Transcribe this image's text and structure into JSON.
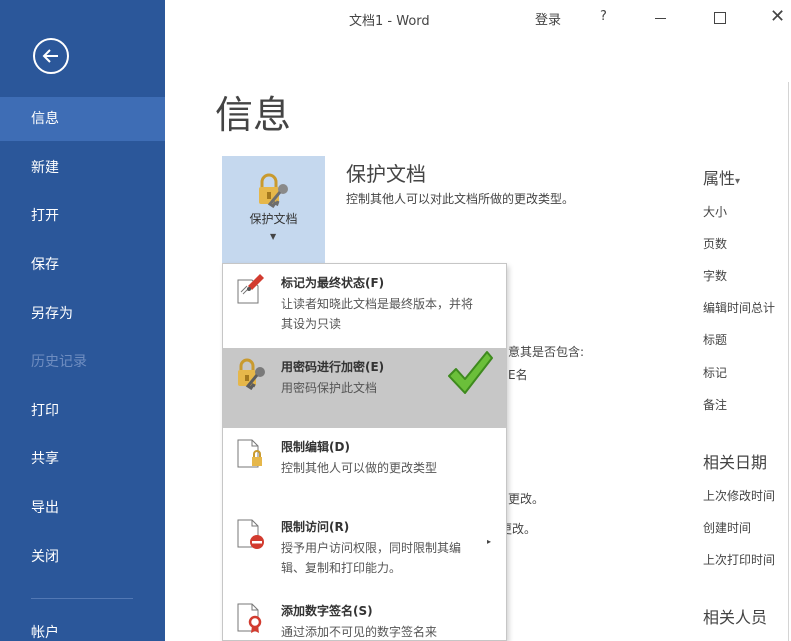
{
  "window": {
    "title": "文档1  -  Word",
    "login": "登录",
    "help": "?"
  },
  "sidebar": {
    "items": [
      {
        "label": "信息",
        "state": "active"
      },
      {
        "label": "新建",
        "state": "normal"
      },
      {
        "label": "打开",
        "state": "normal"
      },
      {
        "label": "保存",
        "state": "normal"
      },
      {
        "label": "另存为",
        "state": "normal"
      },
      {
        "label": "历史记录",
        "state": "disabled"
      },
      {
        "label": "打印",
        "state": "normal"
      },
      {
        "label": "共享",
        "state": "normal"
      },
      {
        "label": "导出",
        "state": "normal"
      },
      {
        "label": "关闭",
        "state": "normal"
      },
      {
        "label": "帐户",
        "state": "normal"
      }
    ]
  },
  "main": {
    "title": "信息",
    "protect": {
      "button_label": "保护文档",
      "heading": "保护文档",
      "description": "控制其他人可以对此文档所做的更改类型。"
    },
    "background_text": {
      "inspect_line": "意其是否包含:",
      "inspect_line2": "E名",
      "versions_line1": "刀更改。",
      "versions_line2": "更改。"
    },
    "properties": {
      "title": "属性",
      "title_arrow": "▾",
      "items": [
        "大小",
        "页数",
        "字数",
        "编辑时间总计",
        "标题",
        "标记",
        "备注"
      ]
    },
    "related_dates": {
      "title": "相关日期",
      "items": [
        "上次修改时间",
        "创建时间",
        "上次打印时间"
      ]
    },
    "related_people": {
      "title": "相关人员"
    }
  },
  "menu": {
    "items": [
      {
        "title": "标记为最终状态(F)",
        "desc": "让读者知晓此文档是最终版本，并将其设为只读",
        "icon": "mark-final-icon"
      },
      {
        "title": "用密码进行加密(E)",
        "desc": "用密码保护此文档",
        "icon": "lock-key-icon",
        "highlight": true
      },
      {
        "title": "限制编辑(D)",
        "desc": "控制其他人可以做的更改类型",
        "icon": "restrict-editing-icon"
      },
      {
        "title": "限制访问(R)",
        "desc": "授予用户访问权限，同时限制其编辑、复制和打印能力。",
        "icon": "restrict-access-icon",
        "submenu": "▸"
      },
      {
        "title": "添加数字签名(S)",
        "desc": "通过添加不可见的数字签名来",
        "icon": "digital-signature-icon"
      }
    ]
  },
  "colors": {
    "sidebar": "#2b579a",
    "sidebar_active": "#3e6db5",
    "protect_button": "#c5d8ee",
    "menu_highlight": "#c7c7c7",
    "checkmark": "#6bbf3a"
  }
}
